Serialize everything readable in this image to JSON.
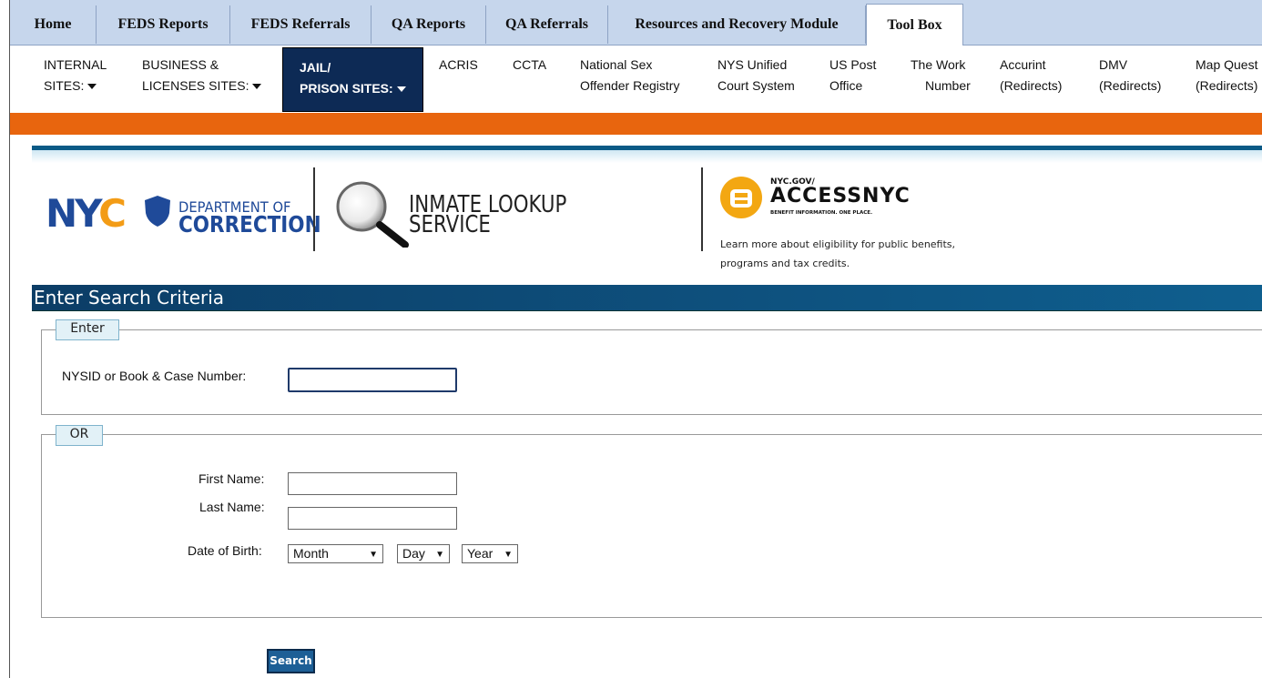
{
  "tabs": [
    {
      "label": "Home"
    },
    {
      "label": "FEDS Reports"
    },
    {
      "label": "FEDS Referrals"
    },
    {
      "label": "QA Reports"
    },
    {
      "label": "QA Referrals"
    },
    {
      "label": "Resources and Recovery Module"
    },
    {
      "label": "Tool Box",
      "active": true
    }
  ],
  "toolbox": {
    "items": [
      {
        "line1": "INTERNAL",
        "line2": "SITES:"
      },
      {
        "line1": "BUSINESS &",
        "line2": "LICENSES SITES:"
      },
      {
        "line1": "JAIL/",
        "line2": "PRISON SITES:"
      },
      {
        "line1": "ACRIS",
        "line2": ""
      },
      {
        "line1": "CCTA",
        "line2": ""
      },
      {
        "line1": "National Sex",
        "line2": "Offender Registry"
      },
      {
        "line1": "NYS Unified",
        "line2": "Court System"
      },
      {
        "line1": "US Post",
        "line2": "Office"
      },
      {
        "line1": "The Work",
        "line2": "Number"
      },
      {
        "line1": "Accurint",
        "line2": "(Redirects)"
      },
      {
        "line1": "DMV",
        "line2": "(Redirects)"
      },
      {
        "line1": "Map Quest",
        "line2": "(Redirects)"
      }
    ]
  },
  "banner": {
    "nyc": {
      "n": "N",
      "y": "Y",
      "c": "C"
    },
    "dept_line1": "DEPARTMENT OF",
    "dept_line2": "CORRECTION",
    "service_line1": "INMATE LOOKUP",
    "service_line2": "SERVICE",
    "access_small": "NYC.GOV/",
    "access_big": "ACCESSNYC",
    "access_tag": "BENEFIT INFORMATION. ONE PLACE.",
    "access_learn": "Learn more about eligibility for public benefits, programs and tax credits."
  },
  "section_title": "Enter Search Criteria",
  "enter_group": {
    "legend": "Enter",
    "nysid_label": "NYSID or Book & Case Number:",
    "nysid_value": ""
  },
  "or_group": {
    "legend": "OR",
    "first_name_label": "First Name:",
    "first_name_value": "",
    "last_name_label": "Last Name:",
    "last_name_value": "",
    "dob_label": "Date of Birth:",
    "month": "Month",
    "day": "Day",
    "year": "Year"
  },
  "search_label": "Search",
  "colors": {
    "tabs_bg": "#c6d6ec",
    "selected_nav": "#0d2a55",
    "orange_bar": "#e8650e",
    "section_bar": "#0f5f8f",
    "nyc_blue": "#1f4a99",
    "nyc_orange": "#f39c16",
    "access_orange": "#f3a712"
  }
}
